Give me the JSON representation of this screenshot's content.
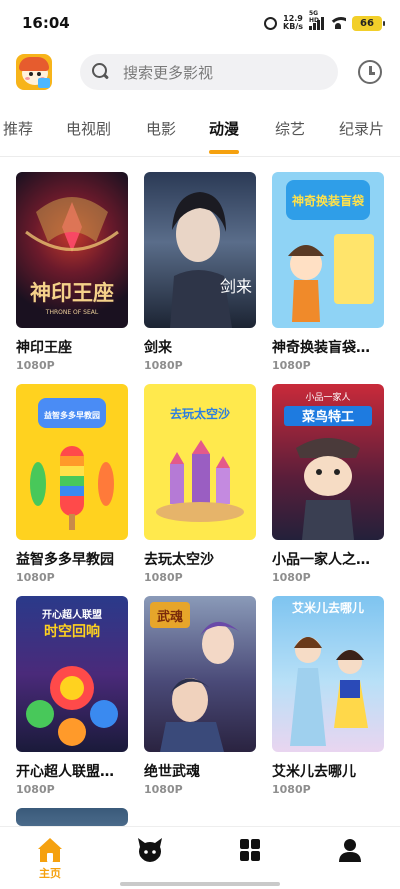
{
  "status_bar": {
    "time": "16:04",
    "speed_value": "12.9",
    "speed_unit": "KB/s",
    "network": "5G HD",
    "battery": "66"
  },
  "search": {
    "placeholder": "搜索更多影视"
  },
  "tabs": [
    {
      "label": "推荐",
      "active": false
    },
    {
      "label": "电视剧",
      "active": false
    },
    {
      "label": "电影",
      "active": false
    },
    {
      "label": "动漫",
      "active": true
    },
    {
      "label": "综艺",
      "active": false
    },
    {
      "label": "纪录片",
      "active": false
    }
  ],
  "colors": {
    "accent": "#f5a10f"
  },
  "cards": [
    {
      "title": "神印王座",
      "resolution": "1080P",
      "poster_text": "神印王座",
      "poster_sub": "THRONE OF SEAL"
    },
    {
      "title": "剑来",
      "resolution": "1080P",
      "poster_text": "剑来"
    },
    {
      "title": "神奇换装盲袋…",
      "resolution": "1080P",
      "poster_text": "神奇换装盲袋"
    },
    {
      "title": "益智多多早教园",
      "resolution": "1080P",
      "poster_text": "益智多多早教园"
    },
    {
      "title": "去玩太空沙",
      "resolution": "1080P",
      "poster_text": "去玩太空沙"
    },
    {
      "title": "小品一家人之…",
      "resolution": "1080P",
      "poster_text": "小品一家人",
      "poster_sub": "菜鸟特工"
    },
    {
      "title": "开心超人联盟…",
      "resolution": "1080P",
      "poster_text": "开心超人联盟",
      "poster_sub": "时空回响"
    },
    {
      "title": "绝世武魂",
      "resolution": "1080P",
      "poster_text": "武魂"
    },
    {
      "title": "艾米儿去哪儿",
      "resolution": "1080P",
      "poster_text": "艾米儿去哪儿"
    }
  ],
  "bottom_nav": [
    {
      "label": "主页",
      "icon": "home-icon",
      "active": true
    },
    {
      "label": "",
      "icon": "mascot-icon",
      "active": false
    },
    {
      "label": "",
      "icon": "grid-icon",
      "active": false
    },
    {
      "label": "",
      "icon": "user-icon",
      "active": false
    }
  ]
}
